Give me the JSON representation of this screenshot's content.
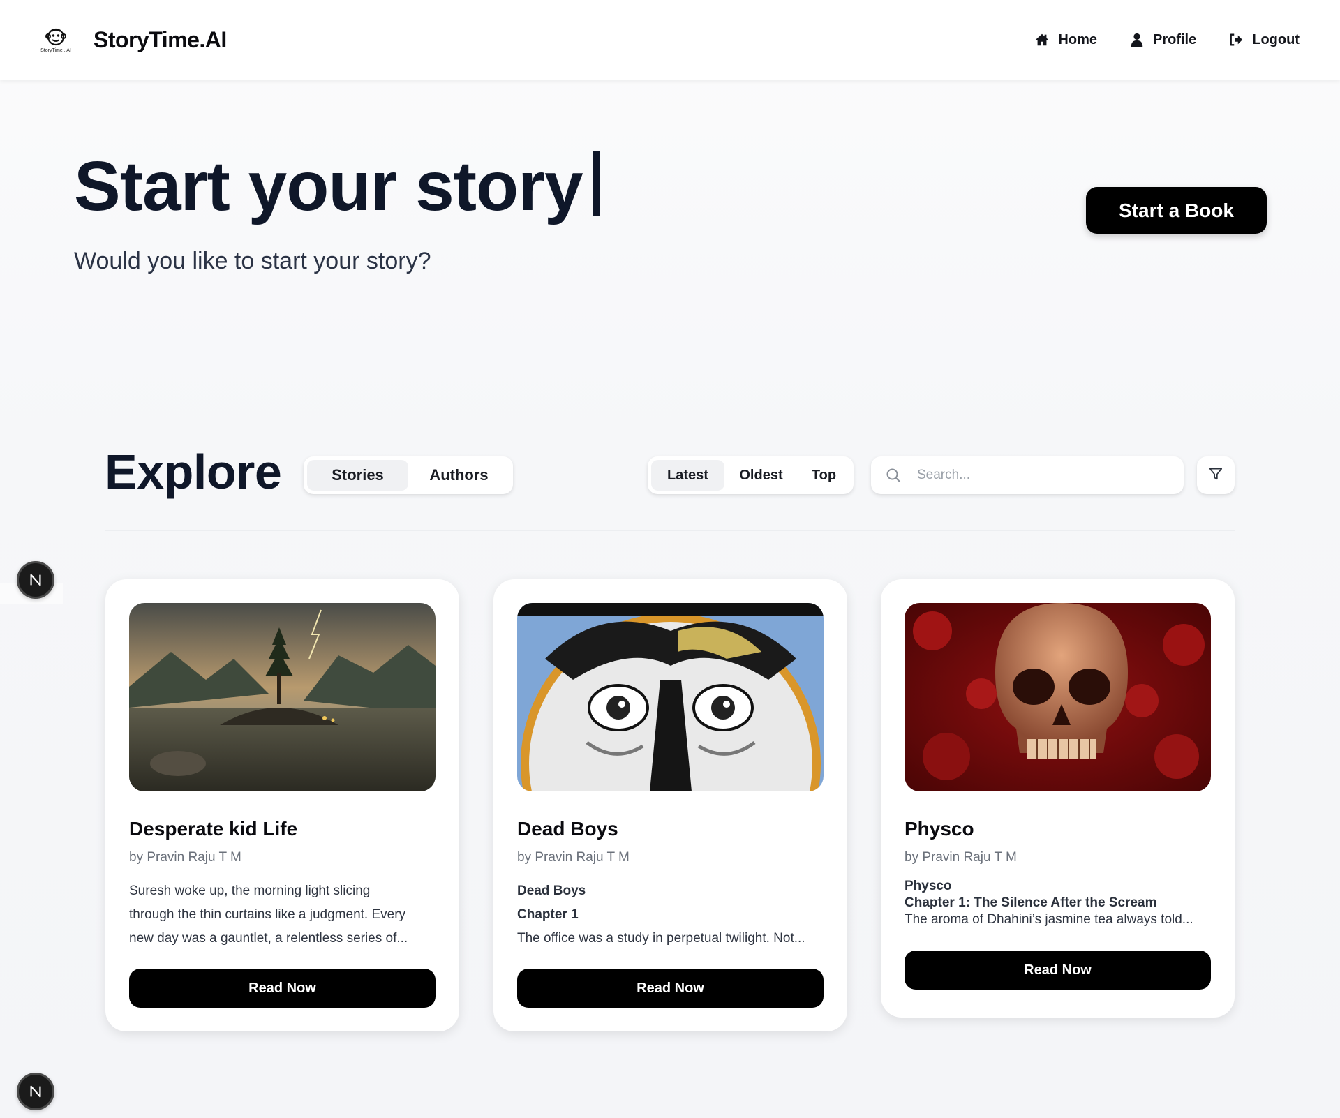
{
  "navbar": {
    "logo_caption": "StoryTime . AI",
    "brand": "StoryTime.AI",
    "links": [
      {
        "label": "Home",
        "icon": "home-icon"
      },
      {
        "label": "Profile",
        "icon": "user-icon"
      },
      {
        "label": "Logout",
        "icon": "logout-icon"
      }
    ]
  },
  "hero": {
    "title": "Start your story",
    "subtitle": "Would you like to start your story?",
    "cta": "Start a Book"
  },
  "explore": {
    "title": "Explore",
    "tabs": [
      {
        "label": "Stories",
        "active": true
      },
      {
        "label": "Authors",
        "active": false
      }
    ],
    "sort": [
      {
        "label": "Latest",
        "active": true
      },
      {
        "label": "Oldest",
        "active": false
      },
      {
        "label": "Top",
        "active": false
      }
    ],
    "search_placeholder": "Search...",
    "filter_icon": "filter-icon"
  },
  "stories": [
    {
      "title": "Desperate kid Life",
      "author": "by Pravin Raju T M",
      "excerpt_lines": [
        "Suresh woke up, the morning light slicing",
        "through the thin curtains like a judgment. Every",
        "new day was a gauntlet, a relentless series of..."
      ],
      "button": "Read Now"
    },
    {
      "title": "Dead Boys",
      "author": "by Pravin Raju T M",
      "excerpt_lines": [
        "Dead Boys",
        "Chapter 1",
        "The office was a study in perpetual twilight. Not..."
      ],
      "button": "Read Now"
    },
    {
      "title": "Physco",
      "author": "by Pravin Raju T M",
      "excerpt_lines": [
        "Physco",
        "Chapter 1: The Silence After the Scream",
        "The aroma of Dhahini’s jasmine tea always told..."
      ],
      "button": "Read Now"
    }
  ],
  "badge_letter": "N",
  "colors": {
    "primary": "#000000",
    "text_dark": "#0f1729",
    "muted": "#6b717b",
    "background": "#f6f7f9"
  }
}
